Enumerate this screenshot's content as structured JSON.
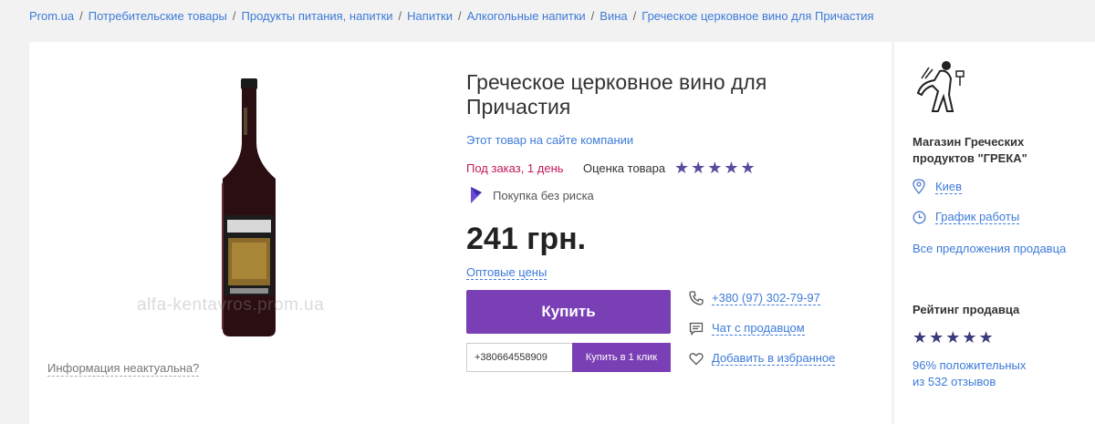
{
  "breadcrumbs": [
    {
      "label": "Prom.ua"
    },
    {
      "label": "Потребительские товары"
    },
    {
      "label": "Продукты питания, напитки"
    },
    {
      "label": "Напитки"
    },
    {
      "label": "Алкогольные напитки"
    },
    {
      "label": "Вина"
    },
    {
      "label": "Греческое церковное вино для Причастия"
    }
  ],
  "image": {
    "watermark": "alfa-kentavros.prom.ua",
    "outdated_link": "Информация неактуальна?"
  },
  "product": {
    "title": "Греческое церковное вино для Причастия",
    "site_link": "Этот товар на сайте компании",
    "availability": "Под заказ, 1 день",
    "rating_label": "Оценка товара",
    "rating_stars": "★★★★★",
    "safe_purchase": "Покупка без риска",
    "price": "241 грн.",
    "wholesale_link": "Оптовые цены",
    "buy_button": "Купить",
    "phone_input_value": "+380664558909",
    "one_click_button": "Купить в 1 клик"
  },
  "contacts": {
    "phone": "+380 (97) 302-79-97",
    "chat": "Чат с продавцом",
    "favorite": "Добавить в избранное"
  },
  "seller": {
    "name": "Магазин Греческих продуктов \"ГРЕКА\"",
    "city": "Киев",
    "schedule": "График работы",
    "all_offers": "Все предложения продавца",
    "rating_title": "Рейтинг продавца",
    "rating_stars": "★★★★★",
    "positive_line1": "96% положительных",
    "positive_line2": "из 532 отзывов"
  },
  "colors": {
    "accent": "#7a3fb5",
    "link": "#3d7bd9",
    "availability": "#c2185b",
    "product_stars": "#5b4b9b",
    "seller_stars": "#3a3a80"
  },
  "icons": [
    "shield-icon",
    "phone-icon",
    "chat-icon",
    "heart-icon",
    "location-pin-icon",
    "clock-icon",
    "seller-logo"
  ]
}
